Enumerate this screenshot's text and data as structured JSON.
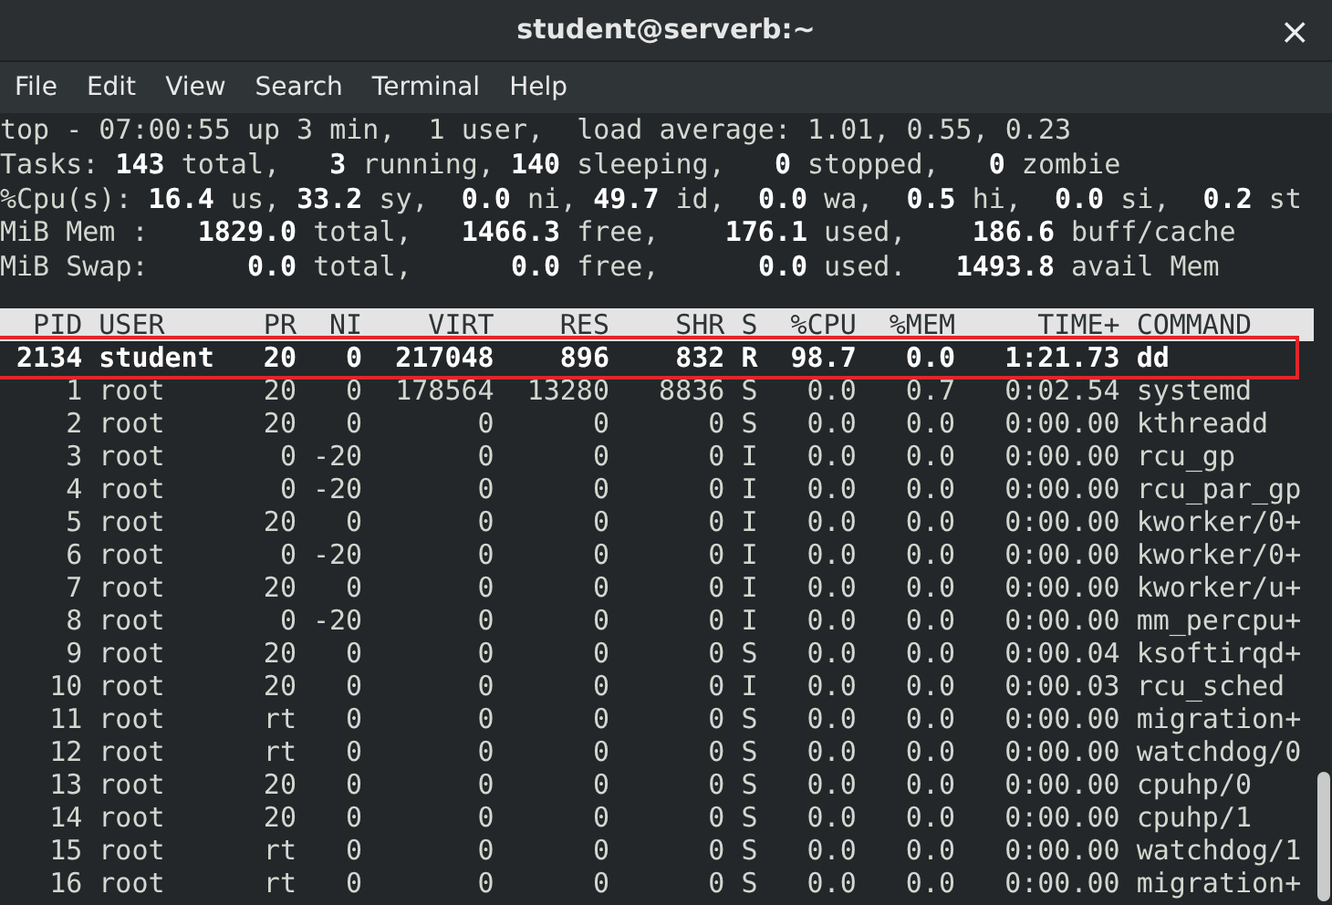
{
  "window": {
    "title": "student@serverb:~",
    "close": "×"
  },
  "menu": [
    "File",
    "Edit",
    "View",
    "Search",
    "Terminal",
    "Help"
  ],
  "summary": [
    "top - 07:00:55 up 3 min,  1 user,  load average: 1.01, 0.55, 0.23",
    "Tasks: **143** total,   **3** running, **140** sleeping,   **0** stopped,   **0** zombie",
    "%Cpu(s): **16.4** us, **33.2** sy,  **0.0** ni, **49.7** id,  **0.0** wa,  **0.5** hi,  **0.0** si,  **0.2** st",
    "MiB Mem :   **1829.0** total,   **1466.3** free,    **176.1** used,    **186.6** buff/cache",
    "MiB Swap:      **0.0** total,      **0.0** free,      **0.0** used.   **1493.8** avail Mem"
  ],
  "table": {
    "columns": [
      "PID",
      "USER",
      "PR",
      "NI",
      "VIRT",
      "RES",
      "SHR",
      "S",
      "%CPU",
      "%MEM",
      "TIME+",
      "COMMAND"
    ],
    "rows": [
      {
        "highlighted": true,
        "cells": [
          "2134",
          "student",
          "20",
          "0",
          "217048",
          "896",
          "832",
          "R",
          "98.7",
          "0.0",
          "1:21.73",
          "dd"
        ]
      },
      {
        "highlighted": false,
        "cells": [
          "1",
          "root",
          "20",
          "0",
          "178564",
          "13280",
          "8836",
          "S",
          "0.0",
          "0.7",
          "0:02.54",
          "systemd"
        ]
      },
      {
        "highlighted": false,
        "cells": [
          "2",
          "root",
          "20",
          "0",
          "0",
          "0",
          "0",
          "S",
          "0.0",
          "0.0",
          "0:00.00",
          "kthreadd"
        ]
      },
      {
        "highlighted": false,
        "cells": [
          "3",
          "root",
          "0",
          "-20",
          "0",
          "0",
          "0",
          "I",
          "0.0",
          "0.0",
          "0:00.00",
          "rcu_gp"
        ]
      },
      {
        "highlighted": false,
        "cells": [
          "4",
          "root",
          "0",
          "-20",
          "0",
          "0",
          "0",
          "I",
          "0.0",
          "0.0",
          "0:00.00",
          "rcu_par_gp"
        ]
      },
      {
        "highlighted": false,
        "cells": [
          "5",
          "root",
          "20",
          "0",
          "0",
          "0",
          "0",
          "I",
          "0.0",
          "0.0",
          "0:00.00",
          "kworker/0+"
        ]
      },
      {
        "highlighted": false,
        "cells": [
          "6",
          "root",
          "0",
          "-20",
          "0",
          "0",
          "0",
          "I",
          "0.0",
          "0.0",
          "0:00.00",
          "kworker/0+"
        ]
      },
      {
        "highlighted": false,
        "cells": [
          "7",
          "root",
          "20",
          "0",
          "0",
          "0",
          "0",
          "I",
          "0.0",
          "0.0",
          "0:00.00",
          "kworker/u+"
        ]
      },
      {
        "highlighted": false,
        "cells": [
          "8",
          "root",
          "0",
          "-20",
          "0",
          "0",
          "0",
          "I",
          "0.0",
          "0.0",
          "0:00.00",
          "mm_percpu+"
        ]
      },
      {
        "highlighted": false,
        "cells": [
          "9",
          "root",
          "20",
          "0",
          "0",
          "0",
          "0",
          "S",
          "0.0",
          "0.0",
          "0:00.04",
          "ksoftirqd+"
        ]
      },
      {
        "highlighted": false,
        "cells": [
          "10",
          "root",
          "20",
          "0",
          "0",
          "0",
          "0",
          "I",
          "0.0",
          "0.0",
          "0:00.03",
          "rcu_sched"
        ]
      },
      {
        "highlighted": false,
        "cells": [
          "11",
          "root",
          "rt",
          "0",
          "0",
          "0",
          "0",
          "S",
          "0.0",
          "0.0",
          "0:00.00",
          "migration+"
        ]
      },
      {
        "highlighted": false,
        "cells": [
          "12",
          "root",
          "rt",
          "0",
          "0",
          "0",
          "0",
          "S",
          "0.0",
          "0.0",
          "0:00.00",
          "watchdog/0"
        ]
      },
      {
        "highlighted": false,
        "cells": [
          "13",
          "root",
          "20",
          "0",
          "0",
          "0",
          "0",
          "S",
          "0.0",
          "0.0",
          "0:00.00",
          "cpuhp/0"
        ]
      },
      {
        "highlighted": false,
        "cells": [
          "14",
          "root",
          "20",
          "0",
          "0",
          "0",
          "0",
          "S",
          "0.0",
          "0.0",
          "0:00.00",
          "cpuhp/1"
        ]
      },
      {
        "highlighted": false,
        "cells": [
          "15",
          "root",
          "rt",
          "0",
          "0",
          "0",
          "0",
          "S",
          "0.0",
          "0.0",
          "0:00.00",
          "watchdog/1"
        ]
      },
      {
        "highlighted": false,
        "cells": [
          "16",
          "root",
          "rt",
          "0",
          "0",
          "0",
          "0",
          "S",
          "0.0",
          "0.0",
          "0:00.00",
          "migration+"
        ]
      }
    ]
  }
}
